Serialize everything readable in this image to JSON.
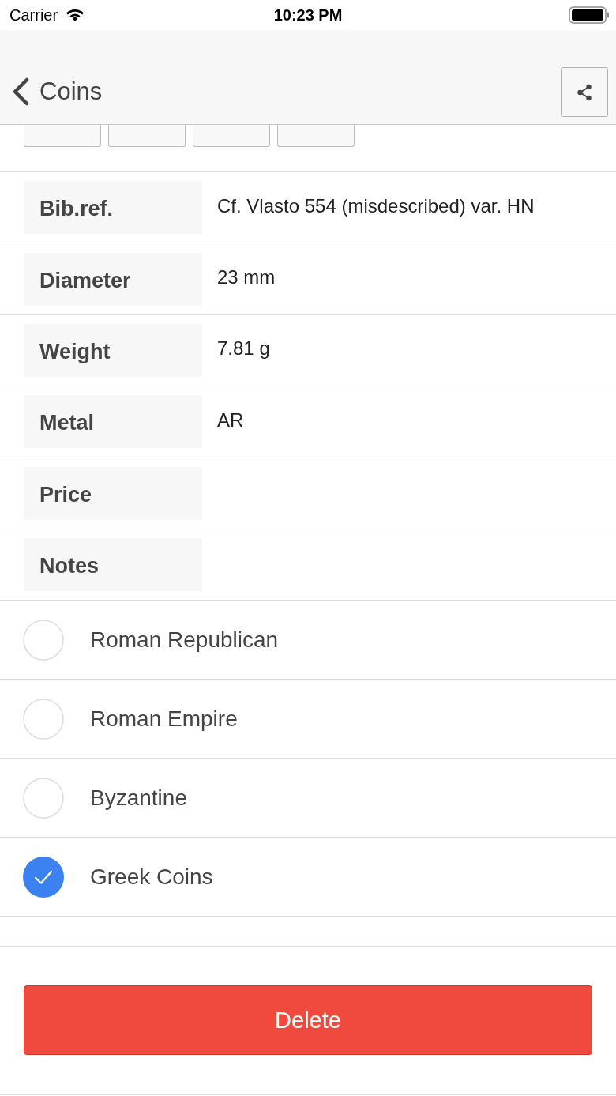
{
  "status_bar": {
    "carrier": "Carrier",
    "time": "10:23 PM"
  },
  "nav": {
    "back_label": "Coins"
  },
  "fields": [
    {
      "label": "Bib.ref.",
      "value": "Cf. Vlasto 554 (misdescribed) var. HN"
    },
    {
      "label": "Diameter",
      "value": "23 mm"
    },
    {
      "label": "Weight",
      "value": "7.81 g"
    },
    {
      "label": "Metal",
      "value": "AR"
    },
    {
      "label": "Price"
    },
    {
      "label": "Notes"
    }
  ],
  "categories": [
    {
      "label": "Roman Republican",
      "selected": false
    },
    {
      "label": "Roman Empire",
      "selected": false
    },
    {
      "label": "Byzantine",
      "selected": false
    },
    {
      "label": "Greek Coins",
      "selected": true
    }
  ],
  "delete_button": {
    "label": "Delete"
  }
}
